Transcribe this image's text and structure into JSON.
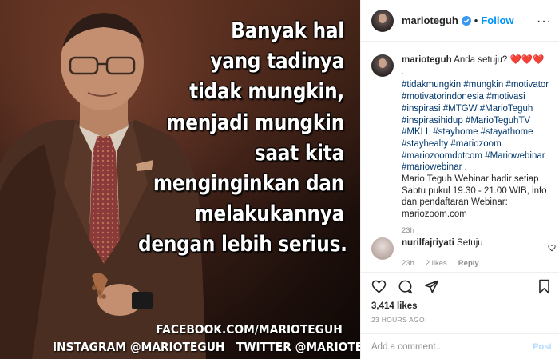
{
  "photo": {
    "quote_lines": [
      "Banyak hal",
      "yang tadinya",
      "tidak mungkin,",
      "menjadi mungkin",
      "saat kita",
      "menginginkan dan",
      "melakukannya",
      "dengan lebih serius."
    ],
    "facebook_credit": "FACEBOOK.COM/MARIOTEGUH",
    "social_credit": "INSTAGRAM @MARIOTEGUH   TWITTER @MARIOTEGUH"
  },
  "header": {
    "username": "marioteguh",
    "separator": "•",
    "follow_label": "Follow",
    "more_label": "···",
    "avatar_icon": "profile-avatar",
    "verified_icon": "verified-badge-icon"
  },
  "caption": {
    "username": "marioteguh",
    "text": "Anda setuju? ❤️❤️❤️",
    "dot": ".",
    "hashtags": [
      "#tidakmungkin",
      "#mungkin",
      "#motivator",
      "#motivatorindonesia",
      "#motivasi",
      "#inspirasi",
      "#MTGW",
      "#MarioTeguh",
      "#inspirasihidup",
      "#MarioTeguhTV",
      "#MKLL",
      "#stayhome",
      "#stayathome",
      "#stayhealty",
      "#mariozoom",
      "#mariozoomdotcom",
      "#Mariowebinar",
      "#mariowebinar"
    ],
    "tags_end": " .",
    "webinar_text": "Mario Teguh Webinar hadir setiap Sabtu pukul 19.30 - 21.00 WIB, info dan pendaftaran Webinar: mariozoom.com",
    "time": "23h"
  },
  "comment": {
    "username": "nurilfajriyati",
    "text": "Setuju",
    "time": "23h",
    "likes": "2 likes",
    "reply_label": "Reply"
  },
  "actions": {
    "likes_count": "3,414 likes",
    "posted_time": "23 HOURS AGO"
  },
  "add_comment": {
    "placeholder": "Add a comment...",
    "post_label": "Post"
  },
  "colors": {
    "link_blue": "#0095f6",
    "hashtag_blue": "#00376b",
    "muted_gray": "#8e8e8e",
    "text_dark": "#262626",
    "heart_red": "#ed4956"
  }
}
